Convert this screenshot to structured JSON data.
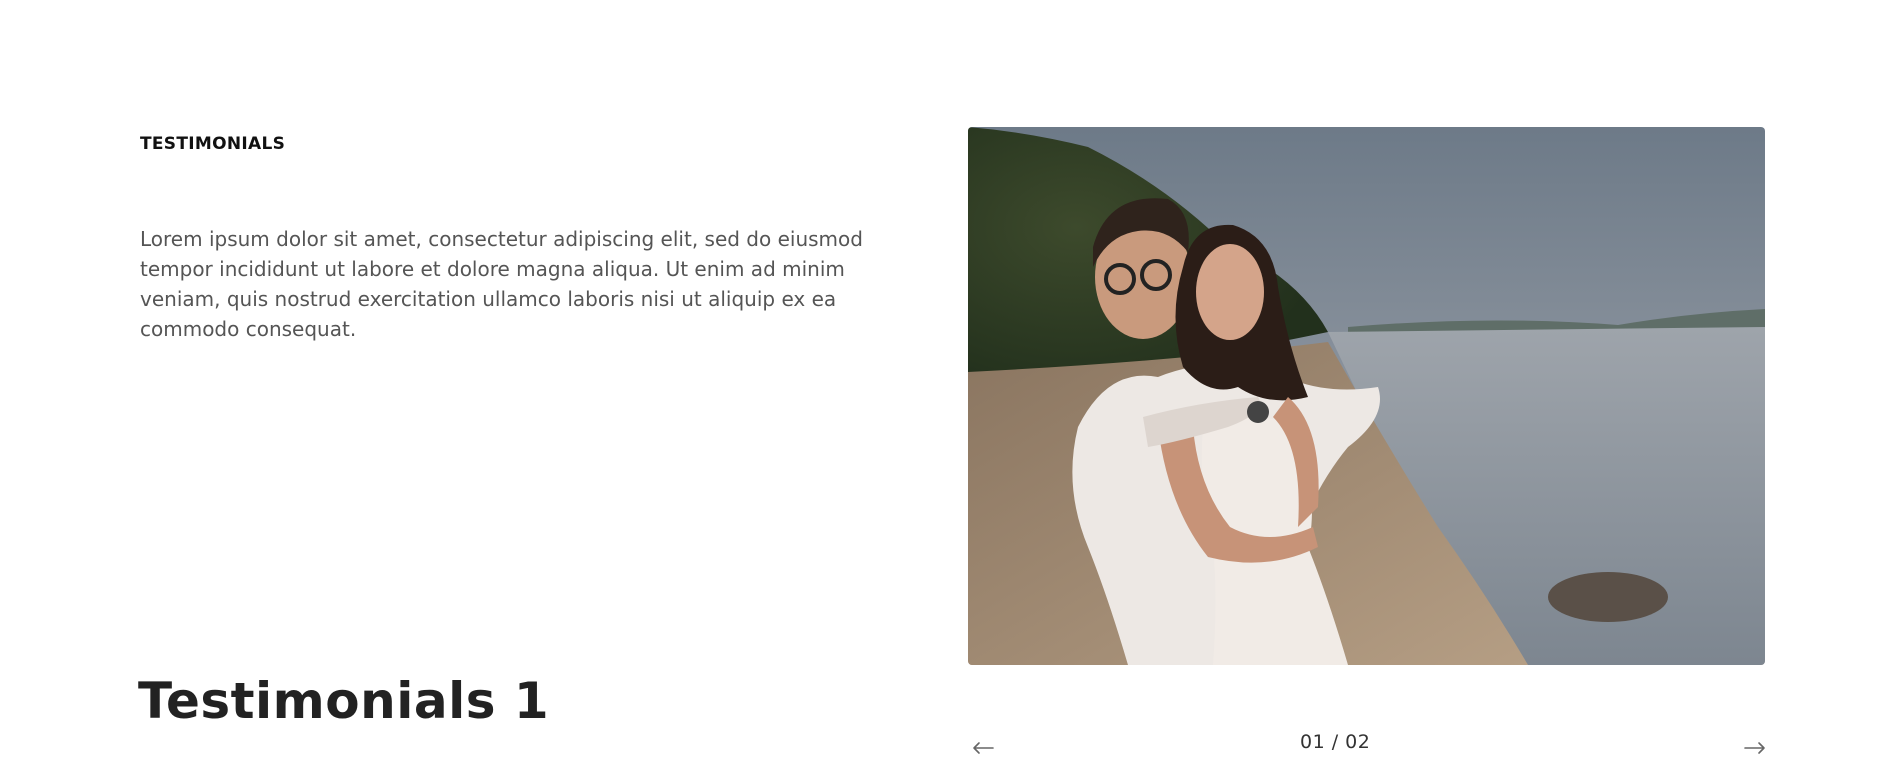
{
  "section": {
    "eyebrow": "TESTIMONIALS",
    "description": "Lorem ipsum dolor sit amet, consectetur adipiscing elit, sed do eiusmod tempor incididunt ut labore et dolore magna aliqua. Ut enim ad minim veniam, quis nostrud exercitation ullamco laboris nisi ut aliquip ex ea commodo consequat.",
    "headline": "Testimonials 1"
  },
  "slider": {
    "counter": "01 / 02",
    "prev_icon": "arrow-left-icon",
    "next_icon": "arrow-right-icon",
    "current": 1,
    "total": 2
  },
  "colors": {
    "text_primary": "#111111",
    "text_body": "#555555",
    "arrow": "#666666"
  }
}
